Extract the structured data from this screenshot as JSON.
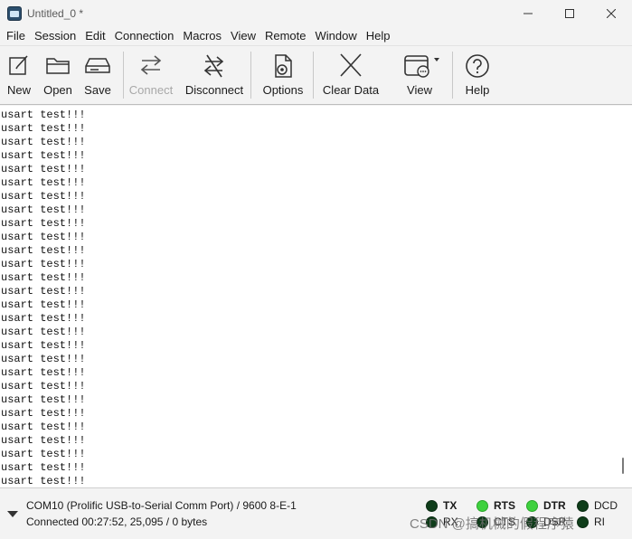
{
  "window": {
    "title": "Untitled_0 *",
    "icon": "terminal-app-icon"
  },
  "menu": [
    "File",
    "Session",
    "Edit",
    "Connection",
    "Macros",
    "View",
    "Remote",
    "Window",
    "Help"
  ],
  "toolbar": {
    "new": "New",
    "open": "Open",
    "save": "Save",
    "connect": "Connect",
    "disconnect": "Disconnect",
    "options": "Options",
    "clear_data": "Clear Data",
    "view": "View",
    "help": "Help"
  },
  "terminal": {
    "lines": [
      "usart test!!!",
      "usart test!!!",
      "usart test!!!",
      "usart test!!!",
      "usart test!!!",
      "usart test!!!",
      "usart test!!!",
      "usart test!!!",
      "usart test!!!",
      "usart test!!!",
      "usart test!!!",
      "usart test!!!",
      "usart test!!!",
      "usart test!!!",
      "usart test!!!",
      "usart test!!!",
      "usart test!!!",
      "usart test!!!",
      "usart test!!!",
      "usart test!!!",
      "usart test!!!",
      "usart test!!!",
      "usart test!!!",
      "usart test!!!",
      "usart test!!!",
      "usart test!!!",
      "usart test!!!",
      "usart test!!!"
    ]
  },
  "status": {
    "port": "COM10 (Prolific USB-to-Serial Comm Port) / 9600 8-E-1",
    "connection": "Connected 00:27:52, 25,095 / 0 bytes",
    "signals": {
      "tx": "TX",
      "rts": "RTS",
      "dtr": "DTR",
      "dcd": "DCD",
      "rx": "RX",
      "cts": "CTS",
      "dsr": "DSR",
      "ri": "RI"
    },
    "colors": {
      "led_on": "#3ed13e",
      "led_off": "#0f3d1a"
    },
    "watermark": "CSDN @搞机械的假程序猿"
  }
}
